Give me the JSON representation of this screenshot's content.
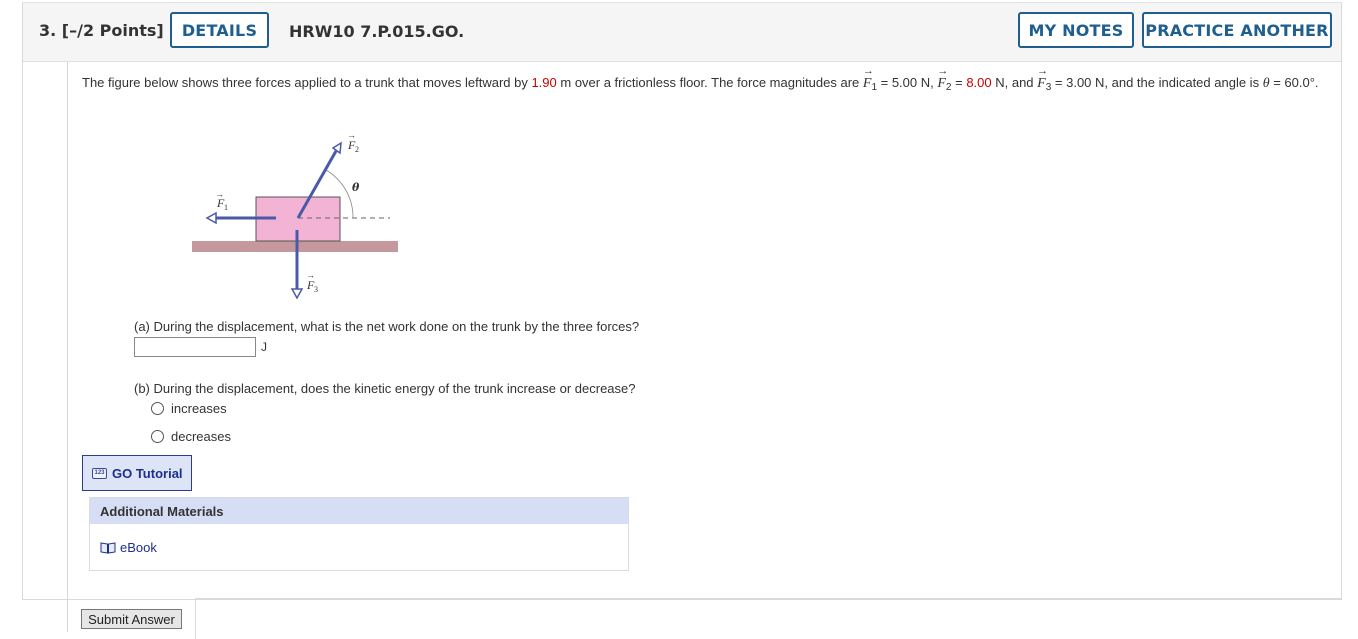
{
  "header": {
    "question_number": "3.",
    "points": "[–/2 Points]",
    "details_label": "DETAILS",
    "question_id": "HRW10 7.P.015.GO.",
    "my_notes_label": "MY NOTES",
    "practice_another_label": "PRACTICE ANOTHER"
  },
  "prompt": {
    "part1": "The figure below shows three forces applied to a trunk that moves leftward by ",
    "distance": "1.90",
    "part2": " m over a frictionless floor. The force magnitudes are ",
    "f1_symbol": "F",
    "f1_sub": "1",
    "f1_value": " = 5.00 N, ",
    "f2_symbol": "F",
    "f2_sub": "2",
    "f2_eq": " = ",
    "f2_value": "8.00",
    "f2_unit": " N, and ",
    "f3_symbol": "F",
    "f3_sub": "3",
    "f3_value": " = 3.00 N, and the indicated angle is ",
    "theta": "θ",
    "theta_value": " = 60.0°."
  },
  "figure": {
    "f1_label": "F",
    "f1_sub": "1",
    "f2_label": "F",
    "f2_sub": "2",
    "f3_label": "F",
    "f3_sub": "3",
    "theta_label": "θ",
    "trunk_color": "#f2b3d4",
    "floor_color": "#c4989c",
    "arrow_color": "#4a5aa8"
  },
  "part_a": {
    "question": "(a) During the displacement, what is the net work done on the trunk by the three forces?",
    "answer_value": "",
    "unit": "J"
  },
  "part_b": {
    "question": "(b) During the displacement, does the kinetic energy of the trunk increase or decrease?",
    "options": [
      "increases",
      "decreases"
    ]
  },
  "go_tutorial": {
    "icon_text": "123",
    "label": "GO Tutorial"
  },
  "additional_materials": {
    "heading": "Additional Materials",
    "ebook_label": "eBook"
  },
  "submit_label": "Submit Answer",
  "colors": {
    "accent_blue": "#1f5f8f",
    "highlight_red": "#cc0000"
  }
}
